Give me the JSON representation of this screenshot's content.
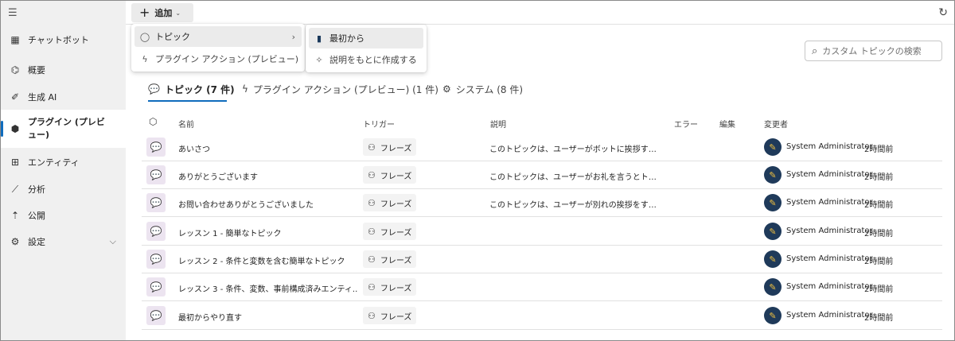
{
  "sidebar": {
    "items": [
      {
        "label": "チャットボット",
        "icon": "grid-icon"
      },
      {
        "label": "概要",
        "icon": "overview-icon"
      },
      {
        "label": "生成 AI",
        "icon": "magic-wand-icon"
      },
      {
        "label": "プラグイン (プレビュー)",
        "icon": "plugin-icon"
      },
      {
        "label": "エンティティ",
        "icon": "entity-icon"
      },
      {
        "label": "分析",
        "icon": "chart-icon"
      },
      {
        "label": "公開",
        "icon": "upload-icon"
      },
      {
        "label": "設定",
        "icon": "gear-icon"
      }
    ]
  },
  "toolbar": {
    "add_label": "追加"
  },
  "add_menu": {
    "items": [
      {
        "label": "トピック",
        "icon": "topic-icon"
      },
      {
        "label": "プラグイン アクション (プレビュー)",
        "icon": "lightning-icon"
      }
    ]
  },
  "topic_submenu": {
    "items": [
      {
        "label": "最初から",
        "icon": "document-icon"
      },
      {
        "label": "説明をもとに作成する",
        "icon": "sparkle-icon"
      }
    ]
  },
  "search": {
    "placeholder": "カスタム トピックの検索"
  },
  "tabs": [
    {
      "label": "トピック (7 件)"
    },
    {
      "label": "プラグイン アクション (プレビュー) (1 件)"
    },
    {
      "label": "システム (8 件)"
    }
  ],
  "table": {
    "headers": {
      "name": "名前",
      "trigger": "トリガー",
      "description": "説明",
      "error": "エラー",
      "edit": "編集",
      "modified_by": "変更者"
    },
    "rows": [
      {
        "name": "あいさつ",
        "trigger": "フレーズ",
        "description": "このトピックは、ユーザーがボットに挨拶する...",
        "user": "System Administrator",
        "time": "2時間前"
      },
      {
        "name": "ありがとうございます",
        "trigger": "フレーズ",
        "description": "このトピックは、ユーザーがお礼を言うとトリ...",
        "user": "System Administrator",
        "time": "2時間前"
      },
      {
        "name": "お問い合わせありがとうございました",
        "trigger": "フレーズ",
        "description": "このトピックは、ユーザーが別れの挨拶をする...",
        "user": "System Administrator",
        "time": "2時間前"
      },
      {
        "name": "レッスン 1 - 簡単なトピック",
        "trigger": "フレーズ",
        "description": "",
        "user": "System Administrator",
        "time": "2時間前"
      },
      {
        "name": "レッスン 2 - 条件と変数を含む簡単なトピック",
        "trigger": "フレーズ",
        "description": "",
        "user": "System Administrator",
        "time": "2時間前"
      },
      {
        "name": "レッスン 3 - 条件、変数、事前構成済みエンティ...",
        "trigger": "フレーズ",
        "description": "",
        "user": "System Administrator",
        "time": "2時間前"
      },
      {
        "name": "最初からやり直す",
        "trigger": "フレーズ",
        "description": "",
        "user": "System Administrator",
        "time": "2時間前"
      }
    ]
  },
  "colors": {
    "accent": "#0f6cbd",
    "sidebar_bg": "#f0f0f0",
    "topic_icon_bg": "#ece4f0",
    "topic_icon": "#7b3f7e"
  }
}
